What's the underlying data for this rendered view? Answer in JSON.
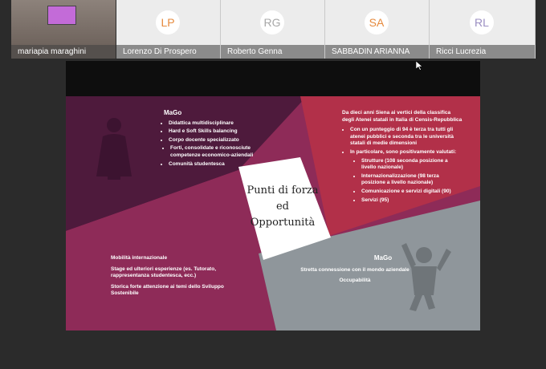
{
  "participants": [
    {
      "name": "mariapia maraghini",
      "initials": "",
      "video": true
    },
    {
      "name": "Lorenzo Di Prospero",
      "initials": "LP",
      "color": "#e68a3d"
    },
    {
      "name": "Roberto Genna",
      "initials": "RG",
      "color": "#a8a8a8"
    },
    {
      "name": "SABBADIN ARIANNA",
      "initials": "SA",
      "color": "#e68a3d"
    },
    {
      "name": "Ricci Lucrezia",
      "initials": "RL",
      "color": "#9b8ec2"
    }
  ],
  "slide": {
    "center_title": [
      "Punti di forza",
      "ed",
      "Opportunità"
    ],
    "top_left": {
      "heading": "MaGo",
      "items": [
        "Didattica multidisciplinare",
        "Hard e Soft Skills balancing",
        "Corpo docente specializzato"
      ],
      "sub_items": [
        "Forti, consolidate e riconosciute competenze economico-aziendali"
      ],
      "last_item": "Comunità studentesca"
    },
    "top_right": {
      "intro": "Da dieci anni Siena ai vertici della classifica degli Atenei statali in Italia di Censis-Repubblica",
      "items": [
        "Con un punteggio di 94 è terza tra tutti gli atenei pubblici e seconda tra le università statali di medie dimensioni",
        "In particolare, sono positivamente valutati:"
      ],
      "sub_items": [
        "Strutture (108 seconda posizione a livello nazionale)",
        "Internazionalizzazione (98 terza posizione a livello nazionale)",
        "Comunicazione e servizi digitali (90)",
        "Servizi (95)"
      ]
    },
    "bottom_left": {
      "lines": [
        "Mobilità internazionale",
        "Stage ed ulteriori esperienze (es. Tutorato, rappresentanza studentesca, ecc.)",
        "Storica forte attenzione ai temi dello Sviluppo Sostenibile"
      ]
    },
    "bottom_right": {
      "heading": "MaGo",
      "lines": [
        "Stretta connessione con il mondo aziendale",
        "Occupabilità"
      ]
    }
  },
  "colors": {
    "plum": "#4e1a3c",
    "crimson": "#b23049",
    "magenta": "#8e2b58",
    "gray": "#8f969b"
  }
}
